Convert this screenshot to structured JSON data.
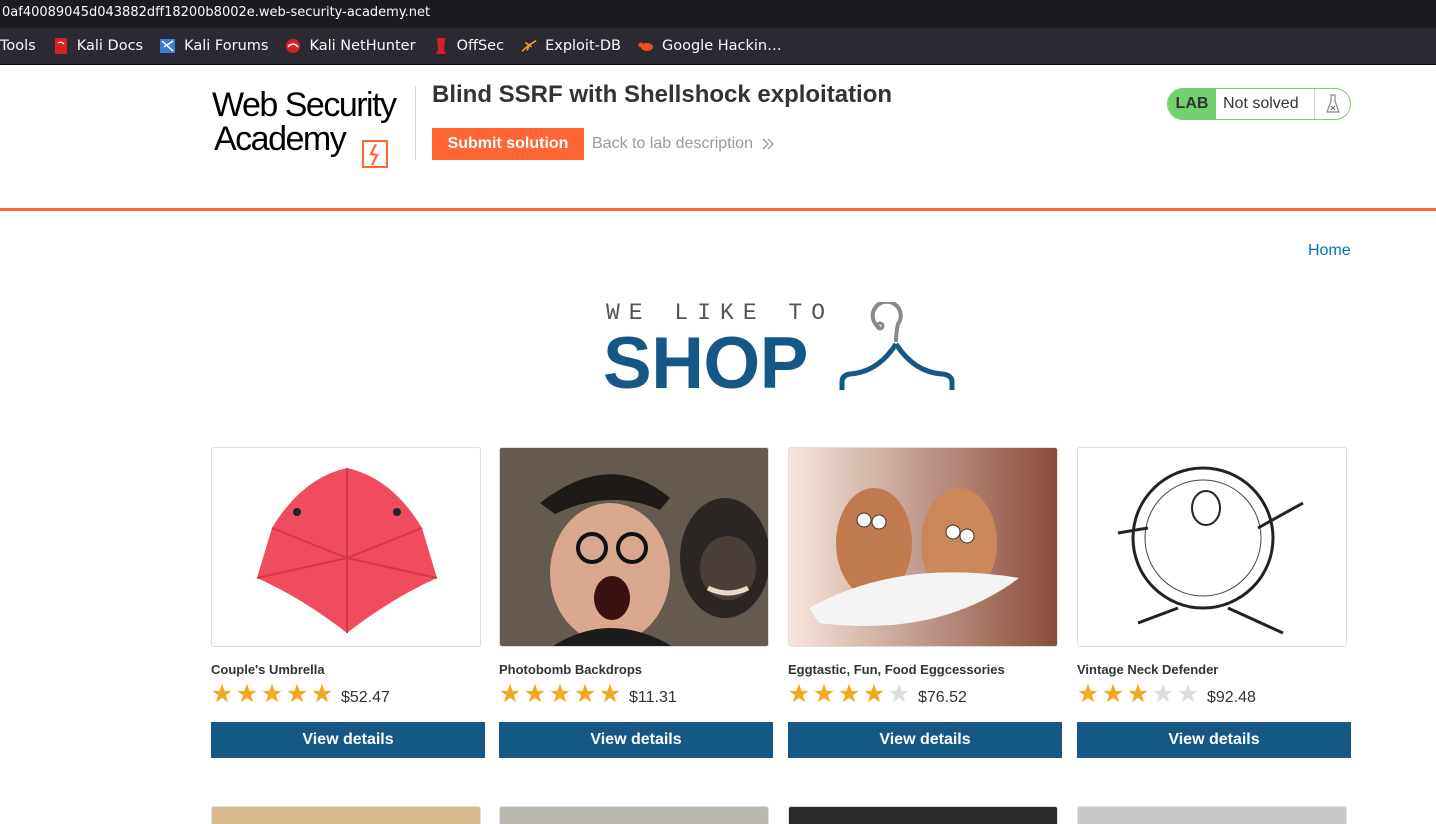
{
  "browser": {
    "url": "0af40089045d043882dff18200b8002e.web-security-academy.net",
    "bookmarks": [
      {
        "label": "Tools",
        "icon": "none"
      },
      {
        "label": "Kali Docs",
        "icon": "kali-docs-icon"
      },
      {
        "label": "Kali Forums",
        "icon": "kali-forums-icon"
      },
      {
        "label": "Kali NetHunter",
        "icon": "kali-nethunter-icon"
      },
      {
        "label": "OffSec",
        "icon": "offsec-icon"
      },
      {
        "label": "Exploit-DB",
        "icon": "exploit-db-icon"
      },
      {
        "label": "Google Hackin…",
        "icon": "google-hacking-icon"
      }
    ]
  },
  "lab_header": {
    "logo_line1": "Web Security",
    "logo_line2": "Academy",
    "title": "Blind SSRF with Shellshock exploitation",
    "submit_label": "Submit solution",
    "back_label": "Back to lab description",
    "status_tag": "LAB",
    "status_text": "Not solved",
    "colors": {
      "accent": "#ff6633",
      "solved_green": "#70d16d"
    }
  },
  "nav": {
    "home_label": "Home"
  },
  "banner": {
    "tagline": "WE LIKE TO",
    "word": "SHOP",
    "color": "#155885"
  },
  "products": [
    {
      "name": "Couple's Umbrella",
      "rating": 5,
      "price": "$52.47",
      "button": "View details",
      "image": "red-umbrella"
    },
    {
      "name": "Photobomb Backdrops",
      "rating": 5,
      "price": "$11.31",
      "button": "View details",
      "image": "man-and-monkey"
    },
    {
      "name": "Eggtastic, Fun, Food Eggcessories",
      "rating": 4,
      "price": "$76.52",
      "button": "View details",
      "image": "googly-eye-eggs"
    },
    {
      "name": "Vintage Neck Defender",
      "rating": 3,
      "price": "$92.48",
      "button": "View details",
      "image": "neck-ruff-sketch"
    }
  ],
  "star_colors": {
    "filled": "#f5a623",
    "empty": "#dddddd"
  }
}
